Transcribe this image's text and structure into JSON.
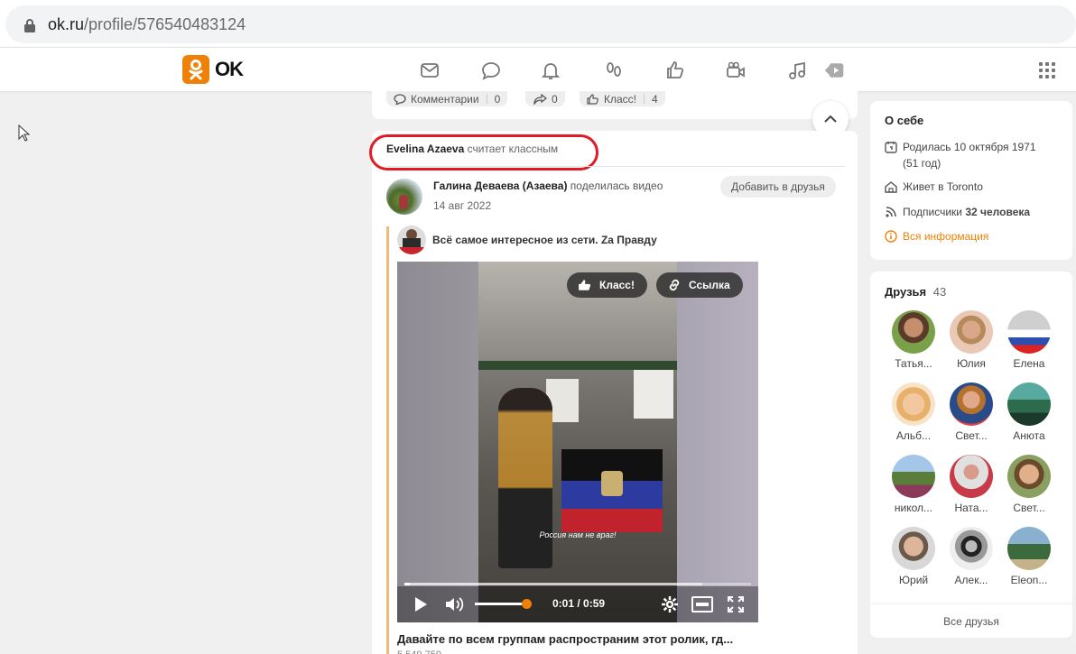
{
  "browser": {
    "url_domain": "ok.ru",
    "url_path": "/profile/576540483124"
  },
  "header": {
    "logo_text": "OK",
    "nav_icons": [
      "envelope-icon",
      "chat-icon",
      "bell-icon",
      "footprints-icon",
      "like-icon",
      "video-camera-icon",
      "music-note-icon",
      "video-play-icon"
    ],
    "accent_color": "#ee8208"
  },
  "prev_post": {
    "comments_label": "Комментарии",
    "comments_count": "0",
    "shares_count": "0",
    "klass_label": "Класс!",
    "klass_count": "4"
  },
  "post": {
    "liker_name": "Evelina Azaeva",
    "liker_action": "считает классным",
    "author_name": "Галина Деваева (Азаева)",
    "author_action": "поделилась видео",
    "date": "14 авг 2022",
    "add_friend_label": "Добавить в друзья",
    "group_name": "Всё самое интересное из сети. Zа Правду",
    "video": {
      "klass_button": "Класс!",
      "link_button": "Ссылка",
      "subtitle": "Россия нам не враг!",
      "time": "0:01 / 0:59",
      "progress": 0.0169,
      "volume": 0.95
    },
    "title": "Давайте по всем группам распространим этот ролик, гд...",
    "views": "5 549 759"
  },
  "about": {
    "heading": "О себе",
    "born": "Родилась 10 октября 1971",
    "age": "(51 год)",
    "lives": "Живет в Toronto",
    "subscribers_prefix": "Подписчики",
    "subscribers_count": "32 человека",
    "all_info": "Вся информация"
  },
  "friends": {
    "heading": "Друзья",
    "count": "43",
    "items": [
      {
        "name": "Татья..."
      },
      {
        "name": "Юлия"
      },
      {
        "name": "Елена"
      },
      {
        "name": "Альб..."
      },
      {
        "name": "Свет..."
      },
      {
        "name": "Анюта"
      },
      {
        "name": "никол..."
      },
      {
        "name": "Ната..."
      },
      {
        "name": "Свет..."
      },
      {
        "name": "Юрий"
      },
      {
        "name": "Алек..."
      },
      {
        "name": "Eleon..."
      }
    ],
    "all_label": "Все друзья"
  }
}
